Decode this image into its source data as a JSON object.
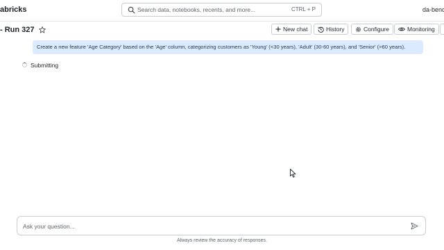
{
  "header": {
    "brand": "abricks",
    "search_placeholder": "Search data, notebooks, recents, and more...",
    "search_shortcut": "CTRL + P",
    "user": "da-bench"
  },
  "page": {
    "title": "- Run 327",
    "actions": {
      "new_chat": "New chat",
      "history": "History",
      "configure": "Configure",
      "monitoring": "Monitoring"
    }
  },
  "conversation": {
    "user_message": "Create a new feature 'Age Category' based on the 'Age' column, categorizing customers as 'Young' (<30 years), 'Adult' (30-60 years), and 'Senior' (>60 years).",
    "status": "Submitting"
  },
  "composer": {
    "placeholder": "Ask your question...",
    "disclaimer": "Always review the accuracy of responses."
  },
  "icons": {
    "search": "search-icon",
    "star": "star-icon",
    "plus": "plus-icon",
    "history": "history-icon",
    "configure": "gear-icon",
    "monitoring": "eye-icon",
    "send": "send-icon",
    "cursor": "mouse-cursor-icon"
  },
  "colors": {
    "prompt_bubble": "#dbeafe",
    "border": "#c9ccd1",
    "text": "#1f2328"
  }
}
